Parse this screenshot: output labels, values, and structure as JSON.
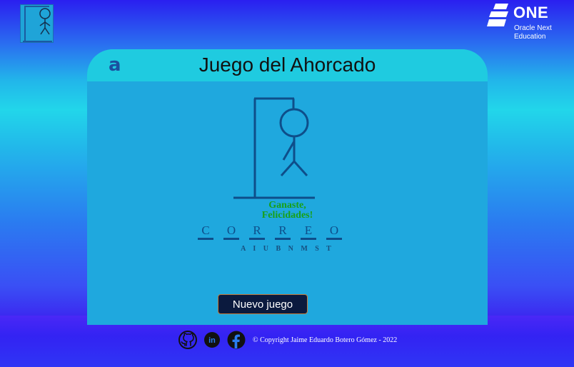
{
  "header": {
    "logo_icon": "hangman-logo-icon",
    "brand": {
      "name": "ONE",
      "subtitle_line1": "Oracle Next",
      "subtitle_line2": "Education"
    }
  },
  "card": {
    "icon": "alura-a-icon",
    "icon_glyph": "a",
    "title": "Juego del Ahorcado",
    "win_line1": "Ganaste,",
    "win_line2": "Felicidades!",
    "word_letters": [
      "C",
      "O",
      "R",
      "R",
      "E",
      "O"
    ],
    "wrong_letters": "A I U B N M S T",
    "new_game_button": "Nuevo juego"
  },
  "footer": {
    "icons": [
      "github-icon",
      "linkedin-icon",
      "facebook-icon"
    ],
    "copyright": "© Copyright Jaime Eduardo Botero Gómez - 2022"
  },
  "colors": {
    "card": "#1fa8de",
    "card_header": "#1fcbe0",
    "drawing": "#0e4e8a",
    "win_text": "#18a018",
    "button_bg": "#0b1a3e"
  }
}
